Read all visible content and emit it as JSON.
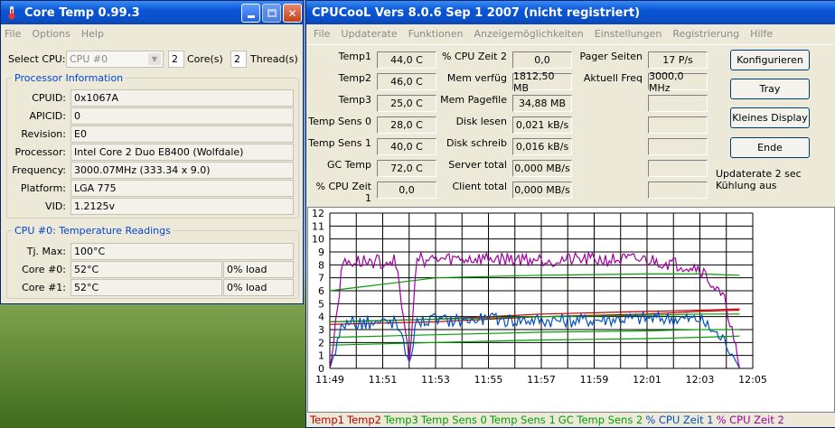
{
  "coretemp": {
    "title": "Core Temp 0.99.3",
    "menu": [
      "File",
      "Options",
      "Help"
    ],
    "select_cpu_label": "Select CPU:",
    "select_cpu_value": "CPU #0",
    "cores_value": "2",
    "cores_label": "Core(s)",
    "threads_value": "2",
    "threads_label": "Thread(s)",
    "proc_group_title": "Processor Information",
    "proc_rows": [
      {
        "label": "CPUID:",
        "value": "0x1067A"
      },
      {
        "label": "APICID:",
        "value": "0"
      },
      {
        "label": "Revision:",
        "value": "E0"
      },
      {
        "label": "Processor:",
        "value": "Intel Core 2 Duo E8400 (Wolfdale)"
      },
      {
        "label": "Frequency:",
        "value": "3000.07MHz (333.34 x 9.0)"
      },
      {
        "label": "Platform:",
        "value": "LGA 775"
      },
      {
        "label": "VID:",
        "value": "1.2125v"
      }
    ],
    "temp_group_title": "CPU #0: Temperature Readings",
    "tjmax_label": "Tj. Max:",
    "tjmax_value": "100°C",
    "core_rows": [
      {
        "label": "Core #0:",
        "temp": "52°C",
        "load": "0% load"
      },
      {
        "label": "Core #1:",
        "temp": "52°C",
        "load": "0% load"
      }
    ]
  },
  "cpucool": {
    "title": "CPUCooL  Vers 8.0.6  Sep  1 2007 (nicht registriert)",
    "menu": [
      "File",
      "Updaterate",
      "Funktionen",
      "Anzeigemöglichkeiten",
      "Einstellungen",
      "Registrierung",
      "Hilfe"
    ],
    "col1": [
      {
        "label": "Temp1",
        "value": "44,0 C"
      },
      {
        "label": "Temp2",
        "value": "46,0 C"
      },
      {
        "label": "Temp3",
        "value": "25,0 C"
      },
      {
        "label": "Temp Sens 0",
        "value": "28,0 C"
      },
      {
        "label": "Temp Sens 1",
        "value": "40,0 C"
      },
      {
        "label": "GC Temp",
        "value": "72,0 C"
      },
      {
        "label": "% CPU Zeit 1",
        "value": "0,0"
      }
    ],
    "col2": [
      {
        "label": "% CPU Zeit 2",
        "value": "0,0"
      },
      {
        "label": "Mem verfüg",
        "value": "1812,50 MB"
      },
      {
        "label": "Mem Pagefile",
        "value": "34,88 MB"
      },
      {
        "label": "Disk lesen",
        "value": "0,021 kB/s"
      },
      {
        "label": "Disk schreib",
        "value": "0,016 kB/s"
      },
      {
        "label": "Server total",
        "value": "0,000 MB/s"
      },
      {
        "label": "Client total",
        "value": "0,000 MB/s"
      }
    ],
    "col3": [
      {
        "label": "Pager Seiten",
        "value": "17 P/s"
      },
      {
        "label": "Aktuell Freq",
        "value": "3000,0 MHz"
      }
    ],
    "buttons": [
      "Konfigurieren",
      "Tray",
      "Kleines Display",
      "Ende"
    ],
    "status_lines": [
      "Updaterate 2 sec",
      "Kühlung aus"
    ],
    "legend": [
      {
        "name": "Temp1",
        "color": "#c00000"
      },
      {
        "name": "Temp2",
        "color": "#c00000"
      },
      {
        "name": "Temp3",
        "color": "#00a000"
      },
      {
        "name": "Temp Sens 0",
        "color": "#00a000"
      },
      {
        "name": "Temp Sens 1",
        "color": "#00a000"
      },
      {
        "name": "GC Temp Sens 2",
        "color": "#00a000"
      },
      {
        "name": "% CPU Zeit 1",
        "color": "#0050c0"
      },
      {
        "name": "% CPU Zeit 2",
        "color": "#a000a0"
      }
    ]
  },
  "chart_data": {
    "type": "line",
    "title": "",
    "xlabel": "",
    "ylabel": "",
    "x_ticks": [
      "11:49",
      "11:51",
      "11:53",
      "11:55",
      "11:57",
      "11:59",
      "12:01",
      "12:03",
      "12:05"
    ],
    "y_ticks": [
      0,
      1,
      2,
      3,
      4,
      5,
      6,
      7,
      8,
      9,
      10,
      11,
      12
    ],
    "ylim": [
      0,
      12
    ],
    "grid": true,
    "series": [
      {
        "name": "Temp1",
        "color": "#c00000",
        "points": [
          [
            0,
            3.4
          ],
          [
            4,
            3.6
          ],
          [
            8,
            4.0
          ],
          [
            12,
            4.2
          ],
          [
            14,
            4.4
          ],
          [
            15.5,
            4.5
          ]
        ]
      },
      {
        "name": "Temp2",
        "color": "#c00000",
        "points": [
          [
            0,
            3.6
          ],
          [
            4,
            3.8
          ],
          [
            8,
            4.2
          ],
          [
            12,
            4.4
          ],
          [
            14,
            4.5
          ],
          [
            15.5,
            4.6
          ]
        ]
      },
      {
        "name": "Temp3",
        "color": "#00a000",
        "points": [
          [
            0,
            1.8
          ],
          [
            4,
            2.0
          ],
          [
            8,
            2.2
          ],
          [
            12,
            2.3
          ],
          [
            14,
            2.4
          ],
          [
            15.5,
            2.5
          ]
        ]
      },
      {
        "name": "Temp Sens 0",
        "color": "#00a000",
        "points": [
          [
            0,
            2.4
          ],
          [
            4,
            2.6
          ],
          [
            8,
            2.8
          ],
          [
            12,
            2.9
          ],
          [
            14,
            3.0
          ],
          [
            15.5,
            3.0
          ]
        ]
      },
      {
        "name": "Temp Sens 1",
        "color": "#00a000",
        "points": [
          [
            0,
            3.6
          ],
          [
            4,
            3.8
          ],
          [
            8,
            4.0
          ],
          [
            12,
            4.1
          ],
          [
            14,
            4.2
          ],
          [
            15.5,
            4.2
          ]
        ]
      },
      {
        "name": "GC Temp Sens 2",
        "color": "#00a000",
        "points": [
          [
            0,
            6.0
          ],
          [
            2,
            6.5
          ],
          [
            4,
            7.0
          ],
          [
            8,
            7.2
          ],
          [
            12,
            7.3
          ],
          [
            14,
            7.3
          ],
          [
            15.5,
            7.2
          ]
        ]
      },
      {
        "name": "% CPU Zeit 1",
        "color": "#0050c0",
        "points": [
          [
            0,
            0
          ],
          [
            0.5,
            3.5
          ],
          [
            2.5,
            3.6
          ],
          [
            3,
            0.5
          ],
          [
            3.3,
            3.7
          ],
          [
            6,
            3.8
          ],
          [
            9,
            3.7
          ],
          [
            12,
            3.9
          ],
          [
            14,
            3.8
          ],
          [
            15,
            2.0
          ],
          [
            15.5,
            0
          ]
        ]
      },
      {
        "name": "% CPU Zeit 2",
        "color": "#a000a0",
        "points": [
          [
            0,
            0
          ],
          [
            0.5,
            8.2
          ],
          [
            2.5,
            8.3
          ],
          [
            3,
            0.5
          ],
          [
            3.3,
            8.4
          ],
          [
            6,
            8.5
          ],
          [
            9,
            8.4
          ],
          [
            12,
            8.4
          ],
          [
            14,
            7.8
          ],
          [
            15,
            5.0
          ],
          [
            15.5,
            0
          ]
        ]
      }
    ]
  }
}
